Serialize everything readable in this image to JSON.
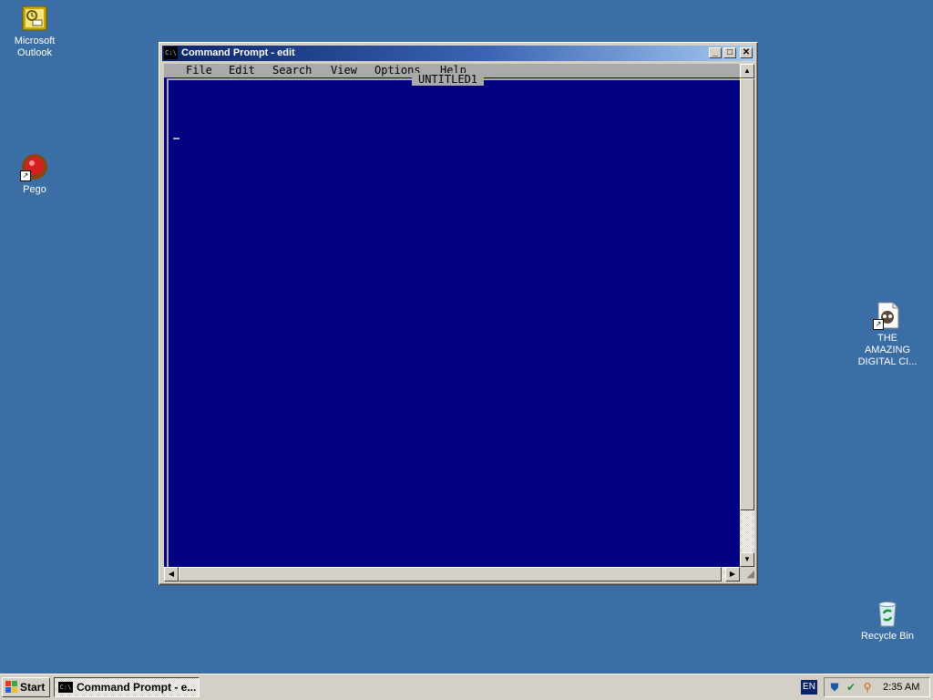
{
  "desktop": {
    "icons": [
      {
        "label": "Microsoft Outlook",
        "icon": "outlook-icon"
      },
      {
        "label": "Pego",
        "icon": "pego-icon"
      },
      {
        "label": "THE AMAZING DIGITAL CI...",
        "icon": "amazing-digital-circus-icon"
      },
      {
        "label": "Recycle Bin",
        "icon": "recycle-bin-icon"
      }
    ]
  },
  "window": {
    "icon_text": "C:\\",
    "title": "Command Prompt - edit",
    "buttons": {
      "minimize": "_",
      "maximize": "□",
      "close": "✕"
    }
  },
  "editor": {
    "menu": [
      "File",
      "Edit",
      "Search",
      "View",
      "Options",
      "Help"
    ],
    "document_title": "UNTITLED1"
  },
  "taskbar": {
    "start_label": "Start",
    "task_label": "Command Prompt - e...",
    "language": "EN",
    "clock": "2:35 AM"
  },
  "colors": {
    "desktop": "#3a6ea5",
    "console_bg": "#000080",
    "menu_bg": "#aaaaaa",
    "title_gradient_start": "#0a246a"
  }
}
